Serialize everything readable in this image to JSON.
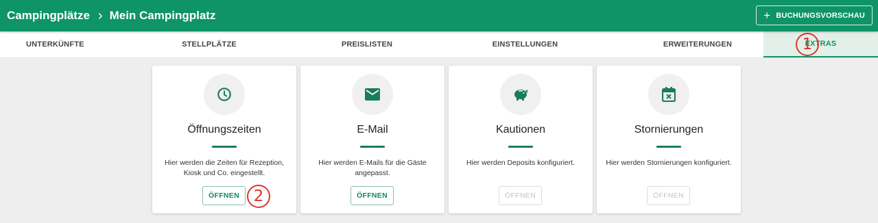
{
  "header": {
    "breadcrumb_root": "Campingplätze",
    "breadcrumb_current": "Mein Campingplatz",
    "preview_label": "BUCHUNGSVORSCHAU",
    "color": "#0e9466"
  },
  "tabs": [
    {
      "label": "UNTERKÜNFTE"
    },
    {
      "label": "STELLPLÄTZE"
    },
    {
      "label": "PREISLISTEN"
    },
    {
      "label": "EINSTELLUNGEN"
    },
    {
      "label": "ERWEITERUNGEN"
    },
    {
      "label": "EXTRAS",
      "active": true
    }
  ],
  "cards": [
    {
      "icon": "clock-icon",
      "title": "Öffnungszeiten",
      "desc": "Hier werden die Zeiten für Rezeption, Kiosk und Co. eingestellt.",
      "button": "ÖFFNEN",
      "enabled": true
    },
    {
      "icon": "mail-icon",
      "title": "E-Mail",
      "desc": "Hier werden E-Mails für die Gäste angepasst.",
      "button": "ÖFFNEN",
      "enabled": true
    },
    {
      "icon": "piggy-bank-icon",
      "title": "Kautionen",
      "desc": "Hier werden Deposits konfiguriert.",
      "button": "ÖFFNEN",
      "enabled": false
    },
    {
      "icon": "calendar-cancel-icon",
      "title": "Stornierungen",
      "desc": "Hier werden Stornierungen konfiguriert.",
      "button": "ÖFFNEN",
      "enabled": false
    }
  ],
  "annotations": {
    "marker_1": "1",
    "marker_2": "2",
    "color": "#d8372c"
  }
}
